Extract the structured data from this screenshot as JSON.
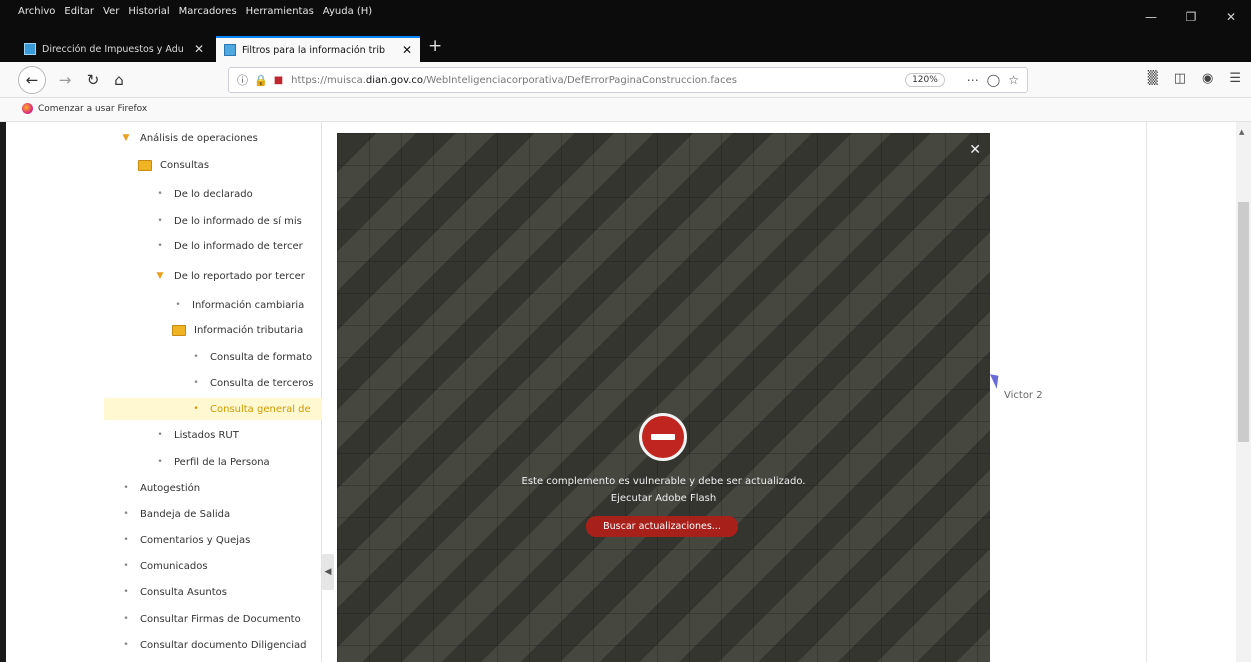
{
  "menubar": {
    "items": [
      "Archivo",
      "Editar",
      "Ver",
      "Historial",
      "Marcadores",
      "Herramientas",
      "Ayuda (H)"
    ]
  },
  "tabs": [
    {
      "label": "Dirección de Impuestos y Adu",
      "active": false
    },
    {
      "label": "Filtros para la información trib",
      "active": true
    }
  ],
  "navbar": {
    "url_prefix": "https://muisca.",
    "url_domain": "dian.gov.co",
    "url_path": "/WebInteligenciacorporativa/DefErrorPaginaConstruccion.faces",
    "zoom": "120%"
  },
  "bookmarks": {
    "first": "Comenzar a usar Firefox"
  },
  "tree": [
    {
      "label": "Análisis de operaciones",
      "type": "expanded"
    },
    {
      "label": "Consultas",
      "type": "folder"
    },
    {
      "label": "De lo declarado",
      "type": "bullet"
    },
    {
      "label": "De lo informado de sí mis",
      "type": "bullet"
    },
    {
      "label": "De lo informado de tercer",
      "type": "bullet"
    },
    {
      "label": "De lo reportado por tercer",
      "type": "expanded"
    },
    {
      "label": "Información cambiaria",
      "type": "bullet"
    },
    {
      "label": "Información tributaria",
      "type": "folder"
    },
    {
      "label": "Consulta de formato",
      "type": "bullet"
    },
    {
      "label": "Consulta de terceros",
      "type": "bullet"
    },
    {
      "label": "Consulta general de",
      "type": "bullet",
      "selected": true
    },
    {
      "label": "Listados RUT",
      "type": "bullet"
    },
    {
      "label": "Perfil de la Persona",
      "type": "bullet"
    },
    {
      "label": "Autogestión",
      "type": "bullet"
    },
    {
      "label": "Bandeja de Salida",
      "type": "bullet"
    },
    {
      "label": "Comentarios y Quejas",
      "type": "bullet"
    },
    {
      "label": "Comunicados",
      "type": "bullet"
    },
    {
      "label": "Consulta Asuntos",
      "type": "bullet"
    },
    {
      "label": "Consultar Firmas de Documento",
      "type": "bullet"
    },
    {
      "label": "Consultar documento Diligenciad",
      "type": "bullet"
    }
  ],
  "flash": {
    "message": "Este complemento es vulnerable y debe ser actualizado.",
    "run": "Ejecutar Adobe Flash",
    "button": "Buscar actualizaciones..."
  },
  "user_label": "Victor 2",
  "colors": {
    "accent_tab": "#0a84ff",
    "flash_button": "#a8201a",
    "selected_text": "#d19a00"
  }
}
